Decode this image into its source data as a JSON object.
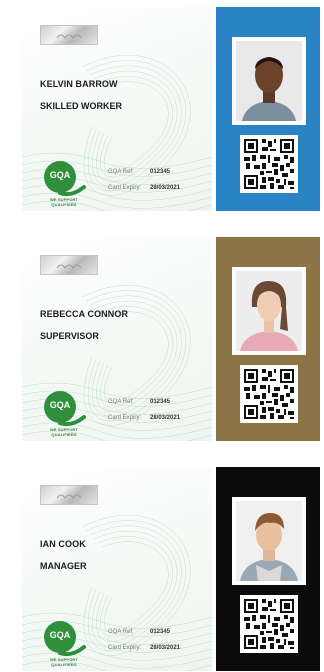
{
  "cards": [
    {
      "name": "KELVIN BARROW",
      "role": "SKILLED WORKER",
      "ref_label": "GQA Ref:",
      "ref_value": "012345",
      "expiry_label": "Card Expiry:",
      "expiry_value": "28/03/2021",
      "logo_text": "GQA",
      "logo_tagline": "WE SUPPORT QUALIFIERS",
      "back_color": "#2a83c4"
    },
    {
      "name": "REBECCA CONNOR",
      "role": "SUPERVISOR",
      "ref_label": "GQA Ref:",
      "ref_value": "012345",
      "expiry_label": "Card Expiry:",
      "expiry_value": "28/03/2021",
      "logo_text": "GQA",
      "logo_tagline": "WE SUPPORT QUALIFIERS",
      "back_color": "#8c7647"
    },
    {
      "name": "IAN COOK",
      "role": "MANAGER",
      "ref_label": "GQA Ref:",
      "ref_value": "012345",
      "expiry_label": "Card Expiry:",
      "expiry_value": "28/03/2021",
      "logo_text": "GQA",
      "logo_tagline": "WE SUPPORT QUALIFIERS",
      "back_color": "#0b0b0b"
    }
  ],
  "colors": {
    "logo_green": "#2f8f3a",
    "guilloche_green": "#b7d9c4"
  }
}
